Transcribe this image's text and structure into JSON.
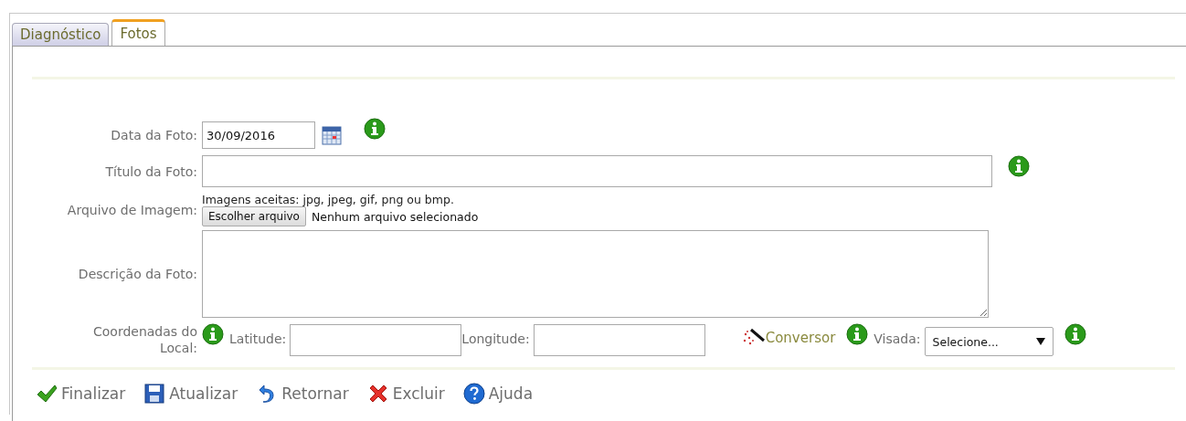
{
  "tabs": [
    {
      "label": "Diagnóstico",
      "selected": false
    },
    {
      "label": "Fotos",
      "selected": true
    }
  ],
  "form": {
    "date": {
      "label": "Data da Foto:",
      "value": "30/09/2016"
    },
    "title": {
      "label": "Título da Foto:"
    },
    "file": {
      "label": "Arquivo de Imagem:",
      "hint": "Imagens aceitas: jpg, jpeg, gif, png ou bmp.",
      "button": "Escolher arquivo",
      "status": "Nenhum arquivo selecionado"
    },
    "description": {
      "label": "Descrição da Foto:"
    },
    "coordinates": {
      "label": "Coordenadas do Local:",
      "latitude_label": "Latitude:",
      "longitude_label": "Longitude:",
      "converter": "Conversor",
      "visada_label": "Visada:",
      "visada_value": "Selecione..."
    }
  },
  "actions": [
    {
      "label": "Finalizar",
      "kind": "finish"
    },
    {
      "label": "Atualizar",
      "kind": "save"
    },
    {
      "label": "Retornar",
      "kind": "back"
    },
    {
      "label": "Excluir",
      "kind": "delete"
    },
    {
      "label": "Ajuda",
      "kind": "help"
    }
  ]
}
